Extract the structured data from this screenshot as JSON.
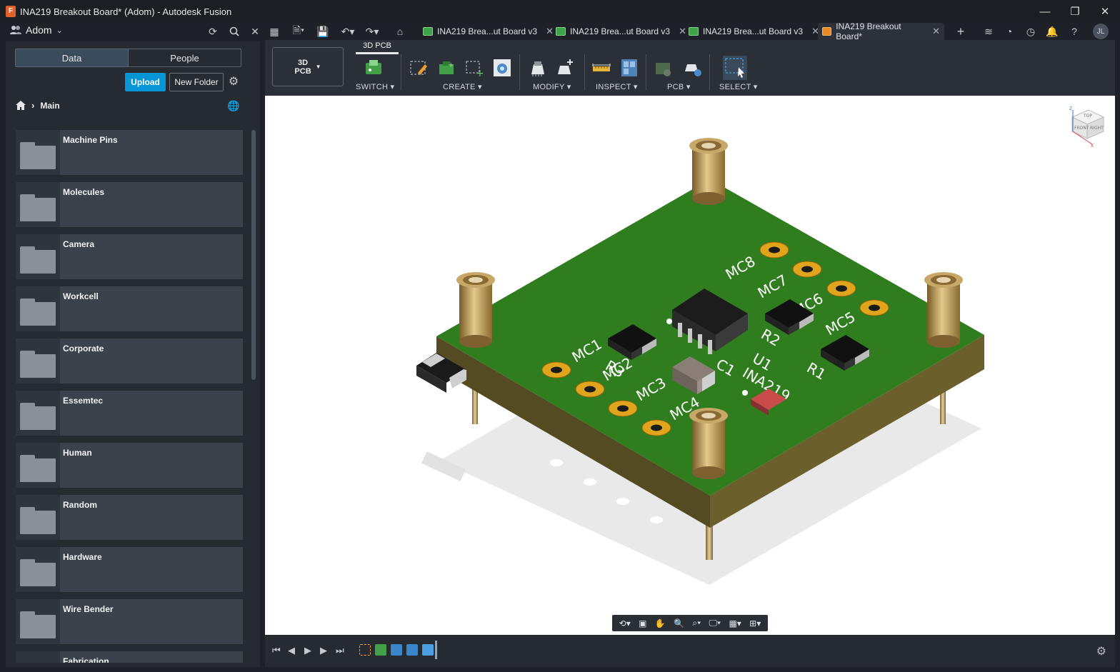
{
  "window": {
    "title": "INA219 Breakout Board* (Adom) - Autodesk Fusion",
    "app_icon_letter": "F",
    "controls": {
      "minimize": "—",
      "restore": "❐",
      "close": "✕"
    }
  },
  "appbar": {
    "team_name": "Adom",
    "tabs": [
      {
        "label": "INA219 Brea...ut Board v3",
        "active": false
      },
      {
        "label": "INA219 Brea...ut Board v3",
        "active": false
      },
      {
        "label": "INA219 Brea...ut Board v3",
        "active": false
      },
      {
        "label": "INA219 Breakout Board*",
        "active": true
      }
    ],
    "user_initials": "JL"
  },
  "data_panel": {
    "tabs": [
      "Data",
      "People"
    ],
    "active_tab": "Data",
    "upload_label": "Upload",
    "new_folder_label": "New Folder",
    "breadcrumb": "Main",
    "folders": [
      "Machine Pins",
      "Molecules",
      "Camera",
      "Workcell",
      "Corporate",
      "Essemtec",
      "Human",
      "Random",
      "Hardware",
      "Wire Bender",
      "Fabrication"
    ]
  },
  "toolbar": {
    "workspace": "3D\nPCB",
    "workspace_line1": "3D",
    "workspace_line2": "PCB",
    "active_tab": "3D PCB",
    "groups": {
      "switch": "SWITCH ▾",
      "create": "CREATE ▾",
      "modify": "MODIFY ▾",
      "inspect": "INSPECT ▾",
      "pcb": "PCB ▾",
      "select": "SELECT ▾"
    }
  },
  "board": {
    "labels": [
      "MC8",
      "MC7",
      "MC6",
      "MC5",
      "MC1",
      "MC2",
      "MC3",
      "MC4",
      "R3",
      "R2",
      "R1",
      "U1",
      "INA219",
      "C1"
    ]
  },
  "viewcube": {
    "top": "TOP",
    "front": "FRONT",
    "right": "RIGHT",
    "z": "Z",
    "x": "X"
  },
  "colors": {
    "accent": "#0696d7",
    "pcb_green": "#2f7d1e",
    "brass": "#b9934f",
    "pad_gold": "#e0a51c"
  }
}
